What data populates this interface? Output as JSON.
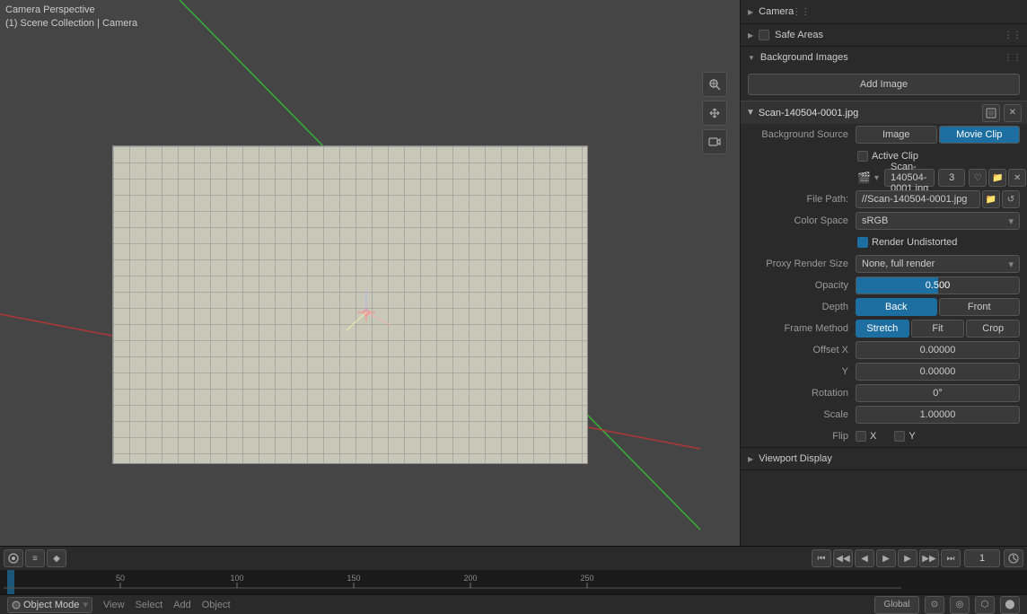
{
  "viewport": {
    "title_line1": "Camera Perspective",
    "title_line2": "(1) Scene Collection | Camera"
  },
  "properties": {
    "camera_section": {
      "label": "Camera",
      "expanded": true
    },
    "safe_areas": {
      "label": "Safe Areas",
      "expanded": false
    },
    "background_images": {
      "label": "Background Images",
      "expanded": true,
      "add_button": "Add Image",
      "image_item": {
        "name": "Scan-140504-0001.jpg",
        "source_label": "Background Source",
        "source_image": "Image",
        "source_movie": "Movie Clip",
        "active_clip_label": "Active Clip",
        "clip_name": "Scan-140504-0001.jpg",
        "clip_num": "3",
        "file_path_label": "File Path:",
        "file_path": "//Scan-140504-0001.jpg",
        "color_space_label": "Color Space",
        "color_space_value": "sRGB",
        "render_undistorted": "Render Undistorted",
        "proxy_label": "Proxy Render Size",
        "proxy_value": "None, full render",
        "opacity_label": "Opacity",
        "opacity_value": "0.500",
        "opacity_pct": 50,
        "depth_label": "Depth",
        "depth_back": "Back",
        "depth_front": "Front",
        "frame_method_label": "Frame Method",
        "frame_stretch": "Stretch",
        "frame_fit": "Fit",
        "frame_crop": "Crop",
        "offset_x_label": "Offset X",
        "offset_x_value": "0.00000",
        "offset_y_label": "Y",
        "offset_y_value": "0.00000",
        "rotation_label": "Rotation",
        "rotation_value": "0°",
        "scale_label": "Scale",
        "scale_value": "1.00000",
        "flip_label": "Flip",
        "flip_x": "X",
        "flip_y": "Y"
      }
    },
    "viewport_display": {
      "label": "Viewport Display"
    }
  },
  "timeline": {
    "frame_current": "1",
    "marks": [
      "50",
      "100",
      "150",
      "200",
      "250"
    ]
  },
  "statusbar": {
    "mode": "Object Mode",
    "view": "View",
    "select": "Select",
    "add": "Add",
    "object": "Object"
  },
  "tools": {
    "zoom": "+",
    "pan": "✋",
    "camera": "📷"
  }
}
